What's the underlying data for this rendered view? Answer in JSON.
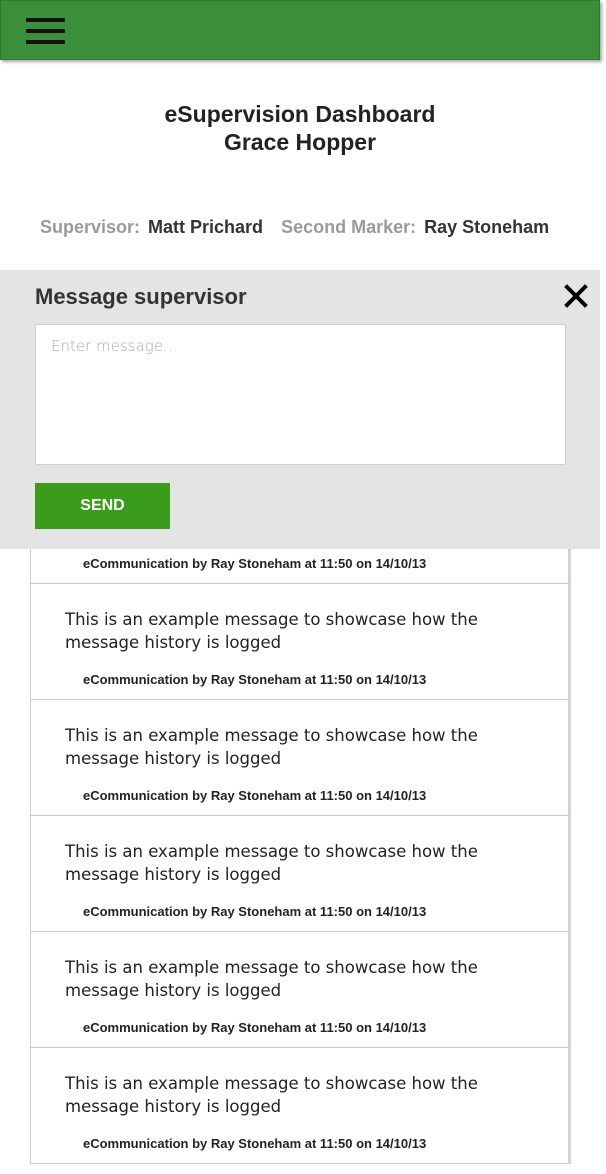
{
  "header": {
    "menu_icon": "hamburger-menu-icon",
    "color": "#3b8f3b"
  },
  "dashboard": {
    "title": "eSupervision Dashboard",
    "student_name": "Grace Hopper"
  },
  "staff": {
    "supervisor_label": "Supervisor:",
    "supervisor_name": "Matt Prichard",
    "second_marker_label": "Second Marker:",
    "second_marker_name": "Ray Stoneham"
  },
  "message_panel": {
    "title": "Message supervisor",
    "close_icon": "close-icon",
    "placeholder": "Enter message...",
    "value": "",
    "send_label": "SEND",
    "send_color": "#3a9c1a"
  },
  "history": {
    "items": [
      {
        "text": "",
        "meta": "eCommunication by Ray Stoneham at 11:50 on 14/10/13"
      },
      {
        "text": "This is an example message to showcase how the message history is logged",
        "meta": "eCommunication by Ray Stoneham at 11:50 on 14/10/13"
      },
      {
        "text": "This is an example message to showcase how the message history is logged",
        "meta": "eCommunication by Ray Stoneham at 11:50 on 14/10/13"
      },
      {
        "text": "This is an example message to showcase how the message history is logged",
        "meta": "eCommunication by Ray Stoneham at 11:50 on 14/10/13"
      },
      {
        "text": "This is an example message to showcase how the message history is logged",
        "meta": "eCommunication by Ray Stoneham at 11:50 on 14/10/13"
      },
      {
        "text": "This is an example message to showcase how the message history is logged",
        "meta": "eCommunication by Ray Stoneham at 11:50 on 14/10/13"
      }
    ]
  }
}
